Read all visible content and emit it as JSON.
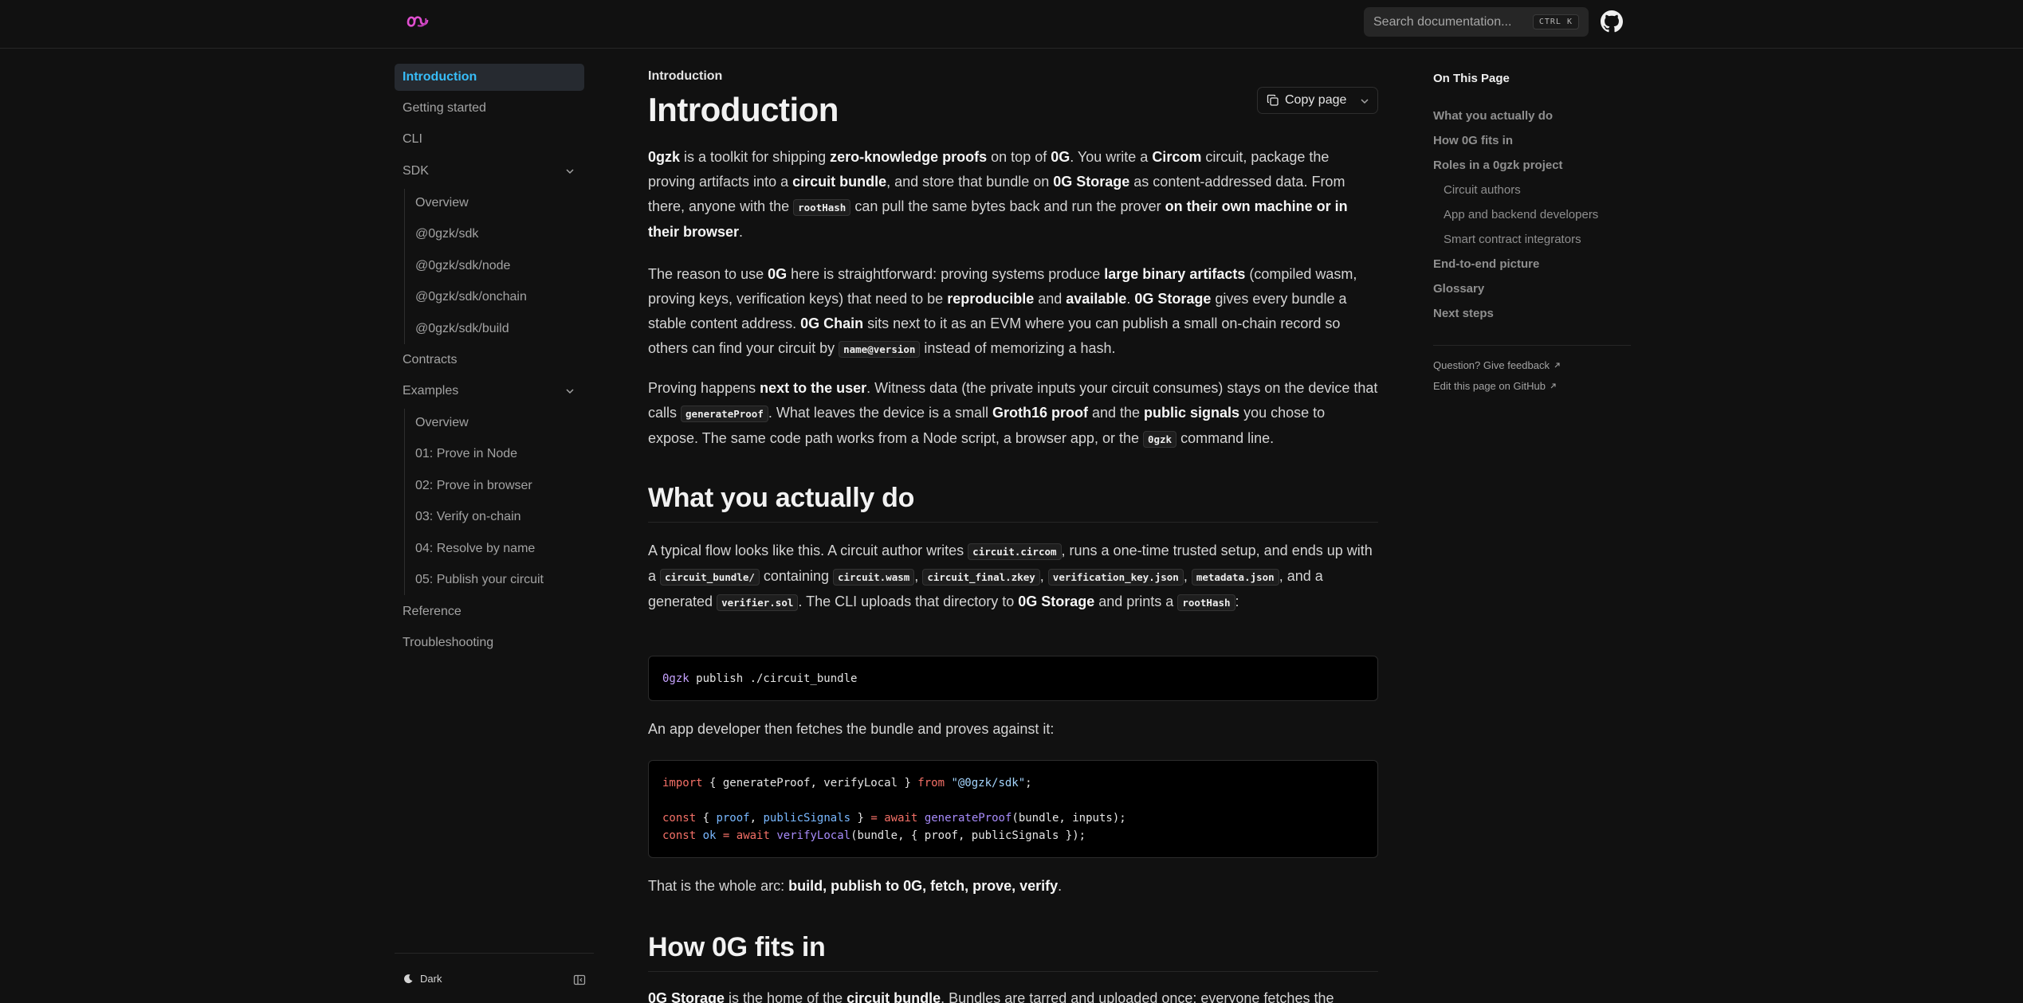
{
  "header": {
    "search_placeholder": "Search documentation...",
    "search_shortcut": "CTRL K"
  },
  "sidebar": {
    "items": [
      {
        "label": "Introduction"
      },
      {
        "label": "Getting started"
      },
      {
        "label": "CLI"
      },
      {
        "label": "SDK"
      },
      {
        "label": "Contracts"
      },
      {
        "label": "Examples"
      },
      {
        "label": "Reference"
      },
      {
        "label": "Troubleshooting"
      }
    ],
    "sdk_children": [
      {
        "label": "Overview"
      },
      {
        "label": "@0gzk/sdk"
      },
      {
        "label": "@0gzk/sdk/node"
      },
      {
        "label": "@0gzk/sdk/onchain"
      },
      {
        "label": "@0gzk/sdk/build"
      }
    ],
    "examples_children": [
      {
        "label": "Overview"
      },
      {
        "label": "01: Prove in Node"
      },
      {
        "label": "02: Prove in browser"
      },
      {
        "label": "03: Verify on-chain"
      },
      {
        "label": "04: Resolve by name"
      },
      {
        "label": "05: Publish your circuit"
      }
    ],
    "theme_label": "Dark"
  },
  "page": {
    "breadcrumb": "Introduction",
    "title": "Introduction",
    "copy_label": "Copy page",
    "p1": {
      "t1": "0gzk",
      "t2": " is a toolkit for shipping ",
      "t3": "zero-knowledge proofs",
      "t4": " on top of ",
      "t5": "0G",
      "t6": ". You write a ",
      "t7": "Circom",
      "t8": " circuit, package the proving artifacts into a ",
      "t9": "circuit bundle",
      "t10": ", and store that bundle on ",
      "t11": "0G Storage",
      "t12": " as content-addressed data. From there, anyone with the ",
      "c1": "rootHash",
      "t13": " can pull the same bytes back and run the prover ",
      "t14": "on their own machine or in their browser",
      "t15": "."
    },
    "p2": {
      "t1": "The reason to use ",
      "t2": "0G",
      "t3": " here is straightforward: proving systems produce ",
      "t4": "large binary artifacts",
      "t5": " (compiled wasm, proving keys, verification keys) that need to be ",
      "t6": "reproducible",
      "t7": " and ",
      "t8": "available",
      "t9": ". ",
      "t10": "0G Storage",
      "t11": " gives every bundle a stable content address. ",
      "t12": "0G Chain",
      "t13": " sits next to it as an EVM where you can publish a small on-chain record so others can find your circuit by ",
      "c1": "name@version",
      "t14": " instead of memorizing a hash."
    },
    "p3": {
      "t1": "Proving happens ",
      "t2": "next to the user",
      "t3": ". Witness data (the private inputs your circuit consumes) stays on the device that calls ",
      "c1": "generateProof",
      "t4": ". What leaves the device is a small ",
      "t5": "Groth16 proof",
      "t6": " and the ",
      "t7": "public signals",
      "t8": " you chose to expose. The same code path works from a Node script, a browser app, or the ",
      "c2": "0gzk",
      "t9": " command line."
    },
    "h2_1": "What you actually do",
    "p4": {
      "t1": "A typical flow looks like this. A circuit author writes ",
      "c1": "circuit.circom",
      "t2": ", runs a one-time trusted setup, and ends up with a ",
      "c2": "circuit_bundle/",
      "t3": " containing ",
      "c3": "circuit.wasm",
      "t4": ", ",
      "c4": "circuit_final.zkey",
      "t5": ", ",
      "c5": "verification_key.json",
      "t6": ", ",
      "c6": "metadata.json",
      "t7": ", and a generated ",
      "c7": "verifier.sol",
      "t8": ". The CLI uploads that directory to ",
      "t9": "0G Storage",
      "t10": " and prints a ",
      "c8": "rootHash",
      "t11": ":"
    },
    "code1": {
      "cmd": "0gzk",
      "rest": " publish ./circuit_bundle"
    },
    "p5": "An app developer then fetches the bundle and proves against it:",
    "code2": {
      "l1_kw": "import",
      "l1_a": " { generateProof, verifyLocal } ",
      "l1_from": "from",
      "l1_sp": " ",
      "l1_str": "\"@0gzk/sdk\"",
      "l1_end": ";",
      "l2_kw": "const",
      "l2_a": " { ",
      "l2_v1": "proof",
      "l2_b": ", ",
      "l2_v2": "publicSignals",
      "l2_c": " } ",
      "l2_eq": "=",
      "l2_sp": " ",
      "l2_aw": "await",
      "l2_sp2": " ",
      "l2_fn": "generateProof",
      "l2_d": "(bundle, inputs);",
      "l3_kw": "const",
      "l3_sp": " ",
      "l3_v": "ok",
      "l3_sp2": " ",
      "l3_eq": "=",
      "l3_sp3": " ",
      "l3_aw": "await",
      "l3_sp4": " ",
      "l3_fn": "verifyLocal",
      "l3_d": "(bundle, { proof, publicSignals });"
    },
    "p6": {
      "t1": "That is the whole arc: ",
      "t2": "build, publish to 0G, fetch, prove, verify",
      "t3": "."
    },
    "h2_2": "How 0G fits in",
    "p7": {
      "t1": "0G Storage",
      "t2": " is the home of the ",
      "t3": "circuit bundle",
      "t4": ". Bundles are tarred and uploaded once; everyone fetches the"
    }
  },
  "toc": {
    "title": "On This Page",
    "items": [
      {
        "label": "What you actually do"
      },
      {
        "label": "How 0G fits in"
      },
      {
        "label": "Roles in a 0gzk project"
      },
      {
        "label": "Circuit authors"
      },
      {
        "label": "App and backend developers"
      },
      {
        "label": "Smart contract integrators"
      },
      {
        "label": "End-to-end picture"
      },
      {
        "label": "Glossary"
      },
      {
        "label": "Next steps"
      }
    ],
    "feedback": "Question? Give feedback",
    "edit": "Edit this page on GitHub"
  },
  "colors": {
    "background": "#111111",
    "accent": "#38bdf8",
    "logo": "#e04fd0"
  },
  "icons": [
    "logo-icon",
    "github-icon",
    "chevron-down-icon",
    "copy-icon",
    "moon-icon",
    "sidebar-collapse-icon",
    "external-link-icon"
  ]
}
